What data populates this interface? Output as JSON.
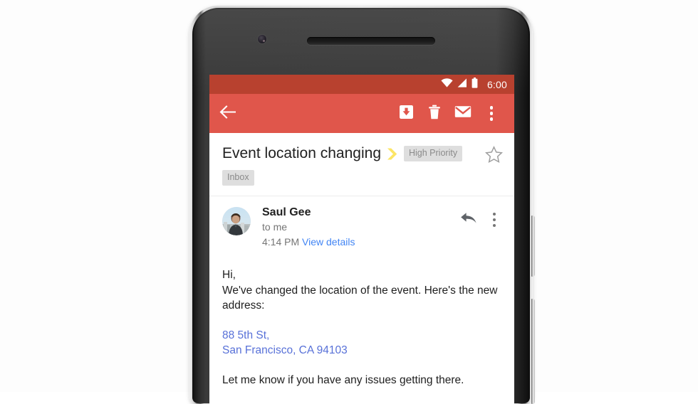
{
  "device": {
    "name": "android-phone",
    "camera_icon": "front-camera-icon",
    "speaker_icon": "earpiece-speaker-icon",
    "power_button": "power-button",
    "volume_button": "volume-rocker-button"
  },
  "status_bar": {
    "time": "6:00",
    "wifi_icon": "wifi-icon",
    "signal_icon": "cellular-signal-icon",
    "battery_icon": "battery-full-icon",
    "background_color": "#b8412f"
  },
  "app_bar": {
    "background_color": "#e0564b",
    "back_icon": "back-arrow-icon",
    "archive_icon": "archive-icon",
    "delete_icon": "trash-icon",
    "mark_unread_icon": "envelope-icon",
    "overflow_icon": "more-vertical-icon"
  },
  "conversation": {
    "subject": "Event location changing",
    "priority_marker_icon": "important-chevron-icon",
    "priority_marker_color": "#fce565",
    "labels": [
      {
        "text": "High Priority"
      },
      {
        "text": "Inbox"
      }
    ],
    "star_icon": "star-outline-icon",
    "message": {
      "avatar_icon": "sender-avatar-photo",
      "sender": "Saul Gee",
      "recipient": "to me",
      "time": "4:14 PM",
      "details_link": "View details",
      "reply_icon": "reply-arrow-icon",
      "overflow_icon": "more-vertical-icon",
      "body": {
        "greeting": "Hi,",
        "paragraph": "We've changed the location of the event. Here's the new address:",
        "address_line1": "88 5th St,",
        "address_line2": "San Francisco, CA 94103",
        "closing": "Let me know if you have any issues getting there."
      }
    }
  },
  "colors": {
    "link": "#4285f4",
    "address_link": "#5871d8",
    "chip_background": "#dedede",
    "chip_text": "#8a8a8a",
    "primary_text": "#212121",
    "secondary_text": "#757575"
  }
}
